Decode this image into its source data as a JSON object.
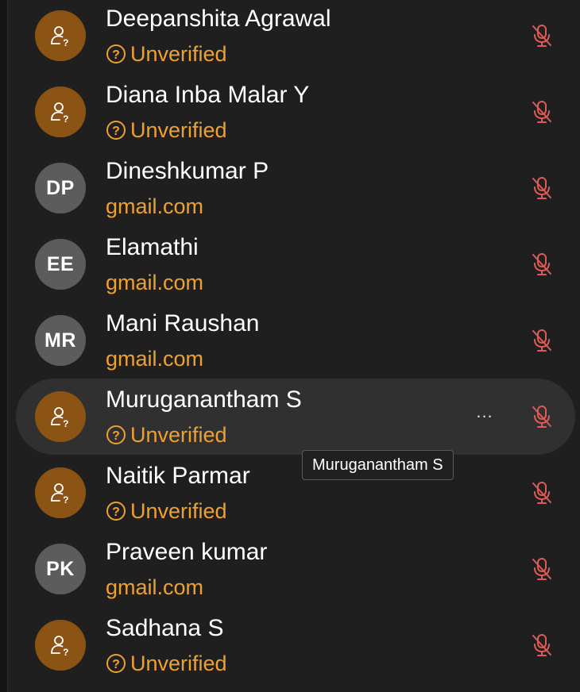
{
  "colors": {
    "background": "#1f1f1f",
    "hover_row": "#303030",
    "guest_avatar": "#8b5414",
    "initials_avatar": "#5c5c5c",
    "subtitle": "#f0a030",
    "mute_icon": "#e05a5a"
  },
  "participants": [
    {
      "name": "Deepanshita Agrawal",
      "subtitle": "Unverified",
      "avatar_type": "guest",
      "initials": "",
      "avatar_icon": "guest-user-icon",
      "status_icon": "question-circle-icon",
      "mic_icon": "microphone-muted-icon"
    },
    {
      "name": "Diana Inba Malar Y",
      "subtitle": "Unverified",
      "avatar_type": "guest",
      "initials": "",
      "avatar_icon": "guest-user-icon",
      "status_icon": "question-circle-icon",
      "mic_icon": "microphone-muted-icon"
    },
    {
      "name": "Dineshkumar P",
      "subtitle": "gmail.com",
      "avatar_type": "initials",
      "initials": "DP",
      "mic_icon": "microphone-muted-icon"
    },
    {
      "name": "Elamathi",
      "subtitle": "gmail.com",
      "avatar_type": "initials",
      "initials": "EE",
      "mic_icon": "microphone-muted-icon"
    },
    {
      "name": "Mani Raushan",
      "subtitle": "gmail.com",
      "avatar_type": "initials",
      "initials": "MR",
      "mic_icon": "microphone-muted-icon"
    },
    {
      "name": "Muruganantham S",
      "subtitle": "Unverified",
      "avatar_type": "guest",
      "initials": "",
      "avatar_icon": "guest-user-icon",
      "status_icon": "question-circle-icon",
      "mic_icon": "microphone-muted-icon",
      "hovered": true,
      "more_label": "...",
      "more_icon": "more-options-icon"
    },
    {
      "name": "Naitik Parmar",
      "subtitle": "Unverified",
      "avatar_type": "guest",
      "initials": "",
      "avatar_icon": "guest-user-icon",
      "status_icon": "question-circle-icon",
      "mic_icon": "microphone-muted-icon"
    },
    {
      "name": "Praveen kumar",
      "subtitle": "gmail.com",
      "avatar_type": "initials",
      "initials": "PK",
      "mic_icon": "microphone-muted-icon"
    },
    {
      "name": "Sadhana S",
      "subtitle": "Unverified",
      "avatar_type": "guest",
      "initials": "",
      "avatar_icon": "guest-user-icon",
      "status_icon": "question-circle-icon",
      "mic_icon": "microphone-muted-icon"
    }
  ],
  "tooltip": {
    "text": "Muruganantham S"
  }
}
